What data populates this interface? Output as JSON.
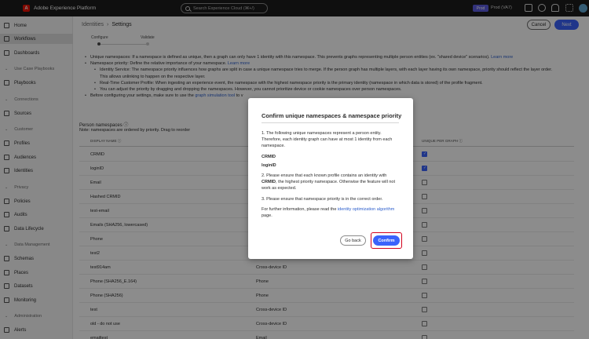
{
  "app": {
    "title": "Adobe Experience Platform",
    "logo_letter": "A"
  },
  "search": {
    "placeholder": "Search Experience Cloud (⌘+/)"
  },
  "sandbox": {
    "badge": "Prod",
    "name": "Prod (VA7)"
  },
  "sidebar": {
    "items": [
      {
        "label": "Home",
        "icon": "home-icon"
      },
      {
        "label": "Workflows",
        "icon": "workflows-icon",
        "active": true
      },
      {
        "label": "Dashboards",
        "icon": "dashboards-icon"
      }
    ],
    "sections": [
      {
        "title": "Use Case Playbooks",
        "items": [
          {
            "label": "Playbooks",
            "icon": "playbooks-icon"
          }
        ]
      },
      {
        "title": "Connections",
        "items": [
          {
            "label": "Sources",
            "icon": "sources-icon"
          }
        ]
      },
      {
        "title": "Customer",
        "items": [
          {
            "label": "Profiles",
            "icon": "profiles-icon"
          },
          {
            "label": "Audiences",
            "icon": "audiences-icon"
          },
          {
            "label": "Identities",
            "icon": "identities-icon"
          }
        ]
      },
      {
        "title": "Privacy",
        "items": [
          {
            "label": "Policies",
            "icon": "policies-icon"
          },
          {
            "label": "Audits",
            "icon": "audits-icon"
          },
          {
            "label": "Data Lifecycle",
            "icon": "data-lifecycle-icon"
          }
        ]
      },
      {
        "title": "Data Management",
        "items": [
          {
            "label": "Schemas",
            "icon": "schemas-icon"
          },
          {
            "label": "Places",
            "icon": "places-icon"
          },
          {
            "label": "Datasets",
            "icon": "datasets-icon"
          },
          {
            "label": "Monitoring",
            "icon": "monitoring-icon"
          }
        ]
      },
      {
        "title": "Administration",
        "items": [
          {
            "label": "Alerts",
            "icon": "alerts-icon"
          }
        ]
      }
    ]
  },
  "breadcrumb": {
    "parent": "Identities",
    "current": "Settings"
  },
  "header": {
    "cancel": "Cancel",
    "next": "Next"
  },
  "steps": [
    {
      "label": "Configure"
    },
    {
      "label": "Validate"
    }
  ],
  "notes": {
    "unique": "Unique namespaces: If a namespace is defined as unique, then a graph can only have 1 identity with this namespace. This prevents graphs representing multiple person entities (ex. \"shared device\" scenarios).",
    "unique_link": "Learn more",
    "priority": "Namespace priority: Define the relative importance of your namespace.",
    "priority_link": "Learn more",
    "sub1": "Identity Service: The namespace priority influences how graphs are split in case a unique namespace tries to merge. If the person graph has multiple layers, with each layer having its own namespace, priority should reflect the layer order. This allows unlinking to happen on the respective layer.",
    "sub2": "Real-Time Customer Profile: When ingesting an experience event, the namespace with the highest namespace priority is the primary identity (namespace in which data is stored) of the profile fragment.",
    "sub3": "You can adjust the priority by dragging and dropping the namespaces. However, you cannot prioritize device or cookie namespaces over person namespaces.",
    "before": "Before configuring your settings, make sure to use the",
    "before_link": "graph simulation tool",
    "before_tail": "to v"
  },
  "table": {
    "section_title": "Person namespaces ⓘ",
    "note": "Note: namespaces are ordered by priority. Drag to reorder",
    "col_display": "DISPLAY NAME ⓘ",
    "col_unique": "UNIQUE PER GRAPH ⓘ",
    "rows": [
      {
        "name": "CRMID",
        "type": "",
        "unique": true
      },
      {
        "name": "loginID",
        "type": "",
        "unique": true
      },
      {
        "name": "Email",
        "type": "",
        "unique": false
      },
      {
        "name": "Hashed CRMID",
        "type": "",
        "unique": false
      },
      {
        "name": "test-email",
        "type": "",
        "unique": false
      },
      {
        "name": "Emails (SHA256, lowercased)",
        "type": "",
        "unique": false
      },
      {
        "name": "Phone",
        "type": "",
        "unique": false
      },
      {
        "name": "test2",
        "type": "",
        "unique": false
      },
      {
        "name": "test914am",
        "type": "Cross-device ID",
        "unique": false
      },
      {
        "name": "Phone (SHA256_E.164)",
        "type": "Phone",
        "unique": false
      },
      {
        "name": "Phone (SHA256)",
        "type": "Phone",
        "unique": false
      },
      {
        "name": "test",
        "type": "Cross-device ID",
        "unique": false
      },
      {
        "name": "old - do not use",
        "type": "Cross-device ID",
        "unique": false
      },
      {
        "name": "emailtest",
        "type": "Email",
        "unique": false
      }
    ]
  },
  "dialog": {
    "title": "Confirm unique namespaces & namespace priority",
    "p1": "1. The following unique namespaces represent a person entity. Therefore, each identity graph can have at most 1 identity from each namespace.",
    "ns1": "CRMID",
    "ns2": "loginID",
    "p2_pre": "2. Please ensure that each known profile contains an identity with",
    "p2_bold": "CRMID",
    "p2_post": ", the highest priority namespace. Otherwise the feature will not work as expected.",
    "p3": "3. Please ensure that namespace priority is in the correct order.",
    "p4_pre": "For further information, please read the",
    "p4_link": "identity optimization algorithm",
    "p4_post": "page.",
    "back": "Go back",
    "confirm": "Confirm"
  },
  "colors": {
    "accent": "#3b63fb",
    "highlight": "#d3001c",
    "topbar": "#1d1d1d"
  }
}
